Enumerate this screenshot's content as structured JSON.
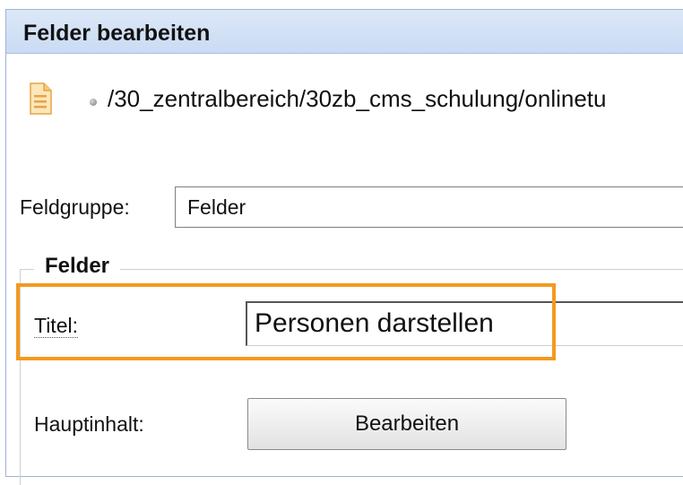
{
  "panel": {
    "title": "Felder bearbeiten"
  },
  "path": {
    "icon": "document-icon",
    "bullet_icon": "bullet-icon",
    "text": "/30_zentralbereich/30zb_cms_schulung/onlinetu"
  },
  "fieldgroup": {
    "label": "Feldgruppe:",
    "value": "Felder"
  },
  "fields": {
    "legend": "Felder",
    "highlight_color": "#f29a1f",
    "title_label": "Titel:",
    "title_value": "Personen darstellen",
    "main_content_label": "Hauptinhalt:",
    "edit_button": "Bearbeiten"
  }
}
